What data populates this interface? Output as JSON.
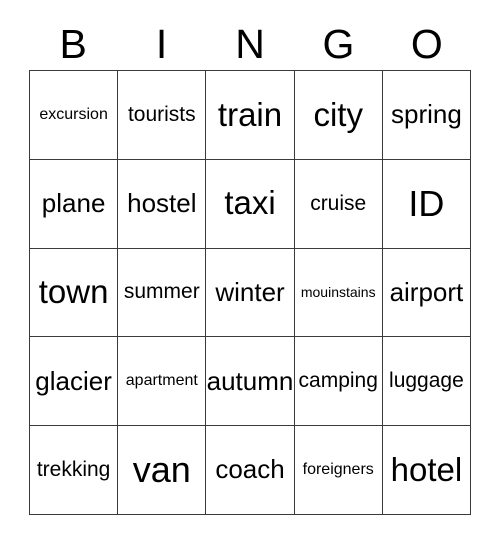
{
  "card": {
    "title": "BINGO",
    "header_letters": [
      "B",
      "I",
      "N",
      "G",
      "O"
    ],
    "rows": 5,
    "columns": 5,
    "border_color": "#3a3a3a",
    "text_color": "#000000",
    "background_color": "#ffffff",
    "cells": [
      [
        {
          "text": "excursion",
          "size": "xs"
        },
        {
          "text": "tourists",
          "size": "sm"
        },
        {
          "text": "train",
          "size": "lg"
        },
        {
          "text": "city",
          "size": "lg"
        },
        {
          "text": "spring",
          "size": "md"
        }
      ],
      [
        {
          "text": "plane",
          "size": "md"
        },
        {
          "text": "hostel",
          "size": "md"
        },
        {
          "text": "taxi",
          "size": "lg"
        },
        {
          "text": "cruise",
          "size": "sm"
        },
        {
          "text": "ID",
          "size": "xl"
        }
      ],
      [
        {
          "text": "town",
          "size": "lg"
        },
        {
          "text": "summer",
          "size": "sm"
        },
        {
          "text": "winter",
          "size": "md"
        },
        {
          "text": "mouinstains",
          "size": "xxs"
        },
        {
          "text": "airport",
          "size": "md"
        }
      ],
      [
        {
          "text": "glacier",
          "size": "md"
        },
        {
          "text": "apartment",
          "size": "xs"
        },
        {
          "text": "autumn",
          "size": "md"
        },
        {
          "text": "camping",
          "size": "sm"
        },
        {
          "text": "luggage",
          "size": "sm"
        }
      ],
      [
        {
          "text": "trekking",
          "size": "sm"
        },
        {
          "text": "van",
          "size": "xl"
        },
        {
          "text": "coach",
          "size": "md"
        },
        {
          "text": "foreigners",
          "size": "xs"
        },
        {
          "text": "hotel",
          "size": "lg"
        }
      ]
    ]
  }
}
